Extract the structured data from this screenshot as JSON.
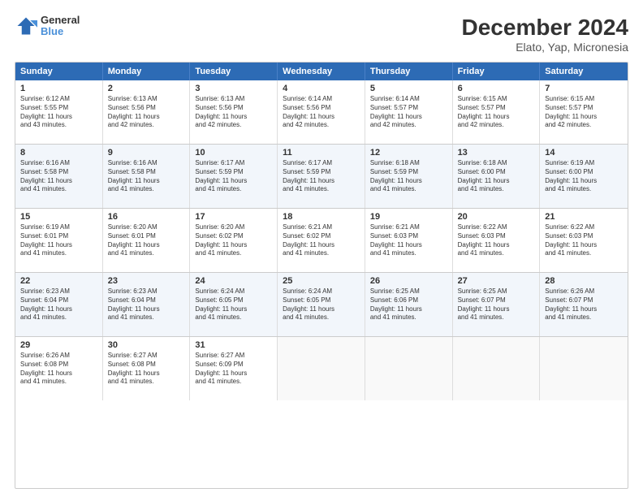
{
  "logo": {
    "line1": "General",
    "line2": "Blue"
  },
  "title": "December 2024",
  "subtitle": "Elato, Yap, Micronesia",
  "headers": [
    "Sunday",
    "Monday",
    "Tuesday",
    "Wednesday",
    "Thursday",
    "Friday",
    "Saturday"
  ],
  "rows": [
    [
      {
        "day": "1",
        "info": "Sunrise: 6:12 AM\nSunset: 5:55 PM\nDaylight: 11 hours\nand 43 minutes."
      },
      {
        "day": "2",
        "info": "Sunrise: 6:13 AM\nSunset: 5:56 PM\nDaylight: 11 hours\nand 42 minutes."
      },
      {
        "day": "3",
        "info": "Sunrise: 6:13 AM\nSunset: 5:56 PM\nDaylight: 11 hours\nand 42 minutes."
      },
      {
        "day": "4",
        "info": "Sunrise: 6:14 AM\nSunset: 5:56 PM\nDaylight: 11 hours\nand 42 minutes."
      },
      {
        "day": "5",
        "info": "Sunrise: 6:14 AM\nSunset: 5:57 PM\nDaylight: 11 hours\nand 42 minutes."
      },
      {
        "day": "6",
        "info": "Sunrise: 6:15 AM\nSunset: 5:57 PM\nDaylight: 11 hours\nand 42 minutes."
      },
      {
        "day": "7",
        "info": "Sunrise: 6:15 AM\nSunset: 5:57 PM\nDaylight: 11 hours\nand 42 minutes."
      }
    ],
    [
      {
        "day": "8",
        "info": "Sunrise: 6:16 AM\nSunset: 5:58 PM\nDaylight: 11 hours\nand 41 minutes."
      },
      {
        "day": "9",
        "info": "Sunrise: 6:16 AM\nSunset: 5:58 PM\nDaylight: 11 hours\nand 41 minutes."
      },
      {
        "day": "10",
        "info": "Sunrise: 6:17 AM\nSunset: 5:59 PM\nDaylight: 11 hours\nand 41 minutes."
      },
      {
        "day": "11",
        "info": "Sunrise: 6:17 AM\nSunset: 5:59 PM\nDaylight: 11 hours\nand 41 minutes."
      },
      {
        "day": "12",
        "info": "Sunrise: 6:18 AM\nSunset: 5:59 PM\nDaylight: 11 hours\nand 41 minutes."
      },
      {
        "day": "13",
        "info": "Sunrise: 6:18 AM\nSunset: 6:00 PM\nDaylight: 11 hours\nand 41 minutes."
      },
      {
        "day": "14",
        "info": "Sunrise: 6:19 AM\nSunset: 6:00 PM\nDaylight: 11 hours\nand 41 minutes."
      }
    ],
    [
      {
        "day": "15",
        "info": "Sunrise: 6:19 AM\nSunset: 6:01 PM\nDaylight: 11 hours\nand 41 minutes."
      },
      {
        "day": "16",
        "info": "Sunrise: 6:20 AM\nSunset: 6:01 PM\nDaylight: 11 hours\nand 41 minutes."
      },
      {
        "day": "17",
        "info": "Sunrise: 6:20 AM\nSunset: 6:02 PM\nDaylight: 11 hours\nand 41 minutes."
      },
      {
        "day": "18",
        "info": "Sunrise: 6:21 AM\nSunset: 6:02 PM\nDaylight: 11 hours\nand 41 minutes."
      },
      {
        "day": "19",
        "info": "Sunrise: 6:21 AM\nSunset: 6:03 PM\nDaylight: 11 hours\nand 41 minutes."
      },
      {
        "day": "20",
        "info": "Sunrise: 6:22 AM\nSunset: 6:03 PM\nDaylight: 11 hours\nand 41 minutes."
      },
      {
        "day": "21",
        "info": "Sunrise: 6:22 AM\nSunset: 6:03 PM\nDaylight: 11 hours\nand 41 minutes."
      }
    ],
    [
      {
        "day": "22",
        "info": "Sunrise: 6:23 AM\nSunset: 6:04 PM\nDaylight: 11 hours\nand 41 minutes."
      },
      {
        "day": "23",
        "info": "Sunrise: 6:23 AM\nSunset: 6:04 PM\nDaylight: 11 hours\nand 41 minutes."
      },
      {
        "day": "24",
        "info": "Sunrise: 6:24 AM\nSunset: 6:05 PM\nDaylight: 11 hours\nand 41 minutes."
      },
      {
        "day": "25",
        "info": "Sunrise: 6:24 AM\nSunset: 6:05 PM\nDaylight: 11 hours\nand 41 minutes."
      },
      {
        "day": "26",
        "info": "Sunrise: 6:25 AM\nSunset: 6:06 PM\nDaylight: 11 hours\nand 41 minutes."
      },
      {
        "day": "27",
        "info": "Sunrise: 6:25 AM\nSunset: 6:07 PM\nDaylight: 11 hours\nand 41 minutes."
      },
      {
        "day": "28",
        "info": "Sunrise: 6:26 AM\nSunset: 6:07 PM\nDaylight: 11 hours\nand 41 minutes."
      }
    ],
    [
      {
        "day": "29",
        "info": "Sunrise: 6:26 AM\nSunset: 6:08 PM\nDaylight: 11 hours\nand 41 minutes."
      },
      {
        "day": "30",
        "info": "Sunrise: 6:27 AM\nSunset: 6:08 PM\nDaylight: 11 hours\nand 41 minutes."
      },
      {
        "day": "31",
        "info": "Sunrise: 6:27 AM\nSunset: 6:09 PM\nDaylight: 11 hours\nand 41 minutes."
      },
      {
        "day": "",
        "info": ""
      },
      {
        "day": "",
        "info": ""
      },
      {
        "day": "",
        "info": ""
      },
      {
        "day": "",
        "info": ""
      }
    ]
  ]
}
